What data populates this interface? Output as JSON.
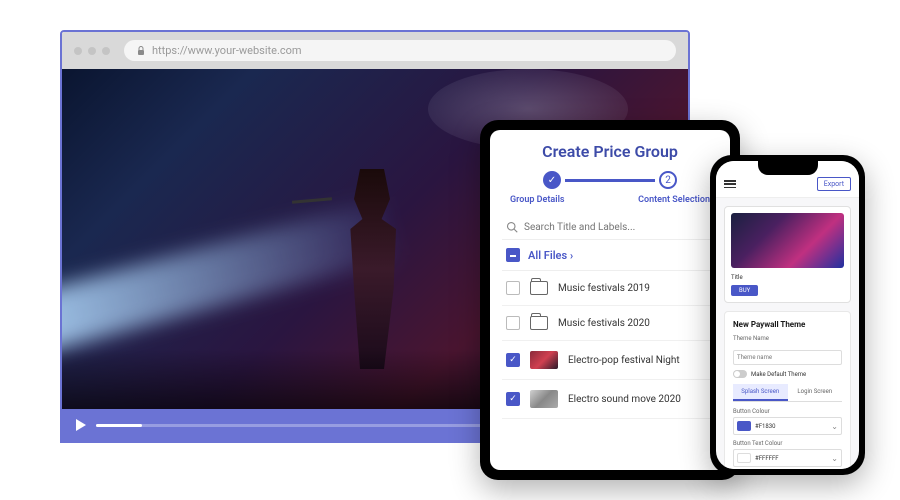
{
  "browser": {
    "url": "https://www.your-website.com"
  },
  "tablet": {
    "title": "Create Price Group",
    "steps": {
      "done_label": "Group Details",
      "active_label": "Content Selection",
      "active_num": "2"
    },
    "search_placeholder": "Search Title and Labels...",
    "all_files": "All Files ›",
    "rows": [
      {
        "name": "Music festivals 2019"
      },
      {
        "name": "Music festivals 2020"
      },
      {
        "name": "Electro-pop festival Night"
      },
      {
        "name": "Electro sound move 2020"
      }
    ]
  },
  "phone": {
    "export": "Export",
    "preview_title": "Title",
    "preview_btn": "BUY",
    "section_title": "New Paywall Theme",
    "theme_label": "Theme Name",
    "theme_placeholder": "Theme name",
    "default_toggle": "Make Default Theme",
    "tab1": "Splash Screen",
    "tab2": "Login Screen",
    "btn_color_label": "Button Colour",
    "btn_color_val": "#F1830",
    "btn_text_label": "Button Text Colour",
    "btn_text_val": "#FFFFFF"
  }
}
